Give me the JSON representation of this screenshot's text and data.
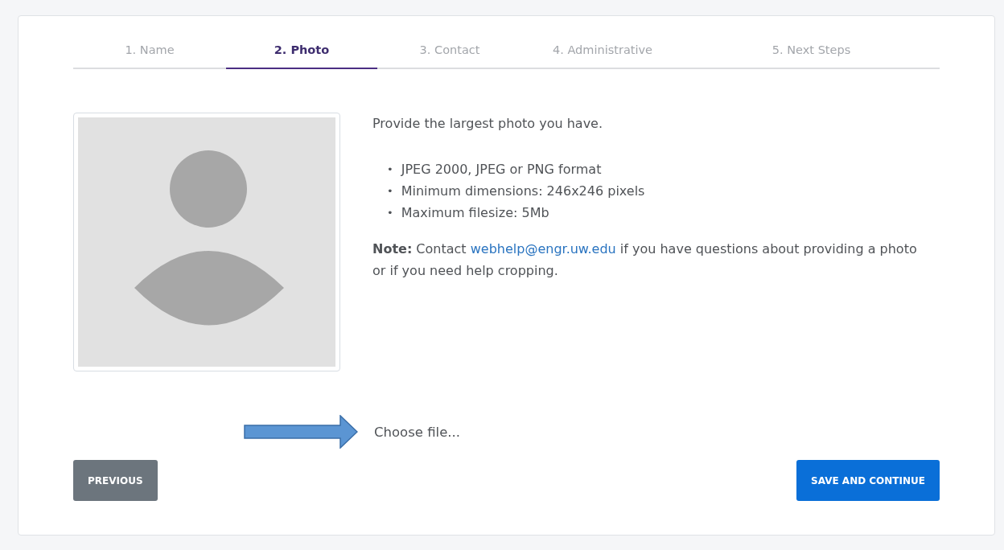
{
  "tabs": [
    {
      "label": "1. Name",
      "selected": false
    },
    {
      "label": "2. Photo",
      "selected": true
    },
    {
      "label": "3. Contact",
      "selected": false
    },
    {
      "label": "4. Administrative",
      "selected": false
    },
    {
      "label": "5. Next Steps",
      "selected": false
    }
  ],
  "intro": "Provide the largest photo you have.",
  "requirements": [
    {
      "bullet": "•",
      "text": "JPEG 2000, JPEG or PNG format"
    },
    {
      "bullet": "•",
      "text": "Minimum dimensions: 246x246 pixels"
    },
    {
      "bullet": "•",
      "text": "Maximum filesize: 5Mb"
    }
  ],
  "note": {
    "prefix": "**Note:** Contact",
    "link": "webhelp@engr.uw.edu",
    "suffix": "if you have questions about providing a photo or if you need help cropping."
  },
  "file_input": "Choose file...",
  "buttons": {
    "previous": "PREVIOUS",
    "next": "SAVE AND CONTINUE"
  }
}
